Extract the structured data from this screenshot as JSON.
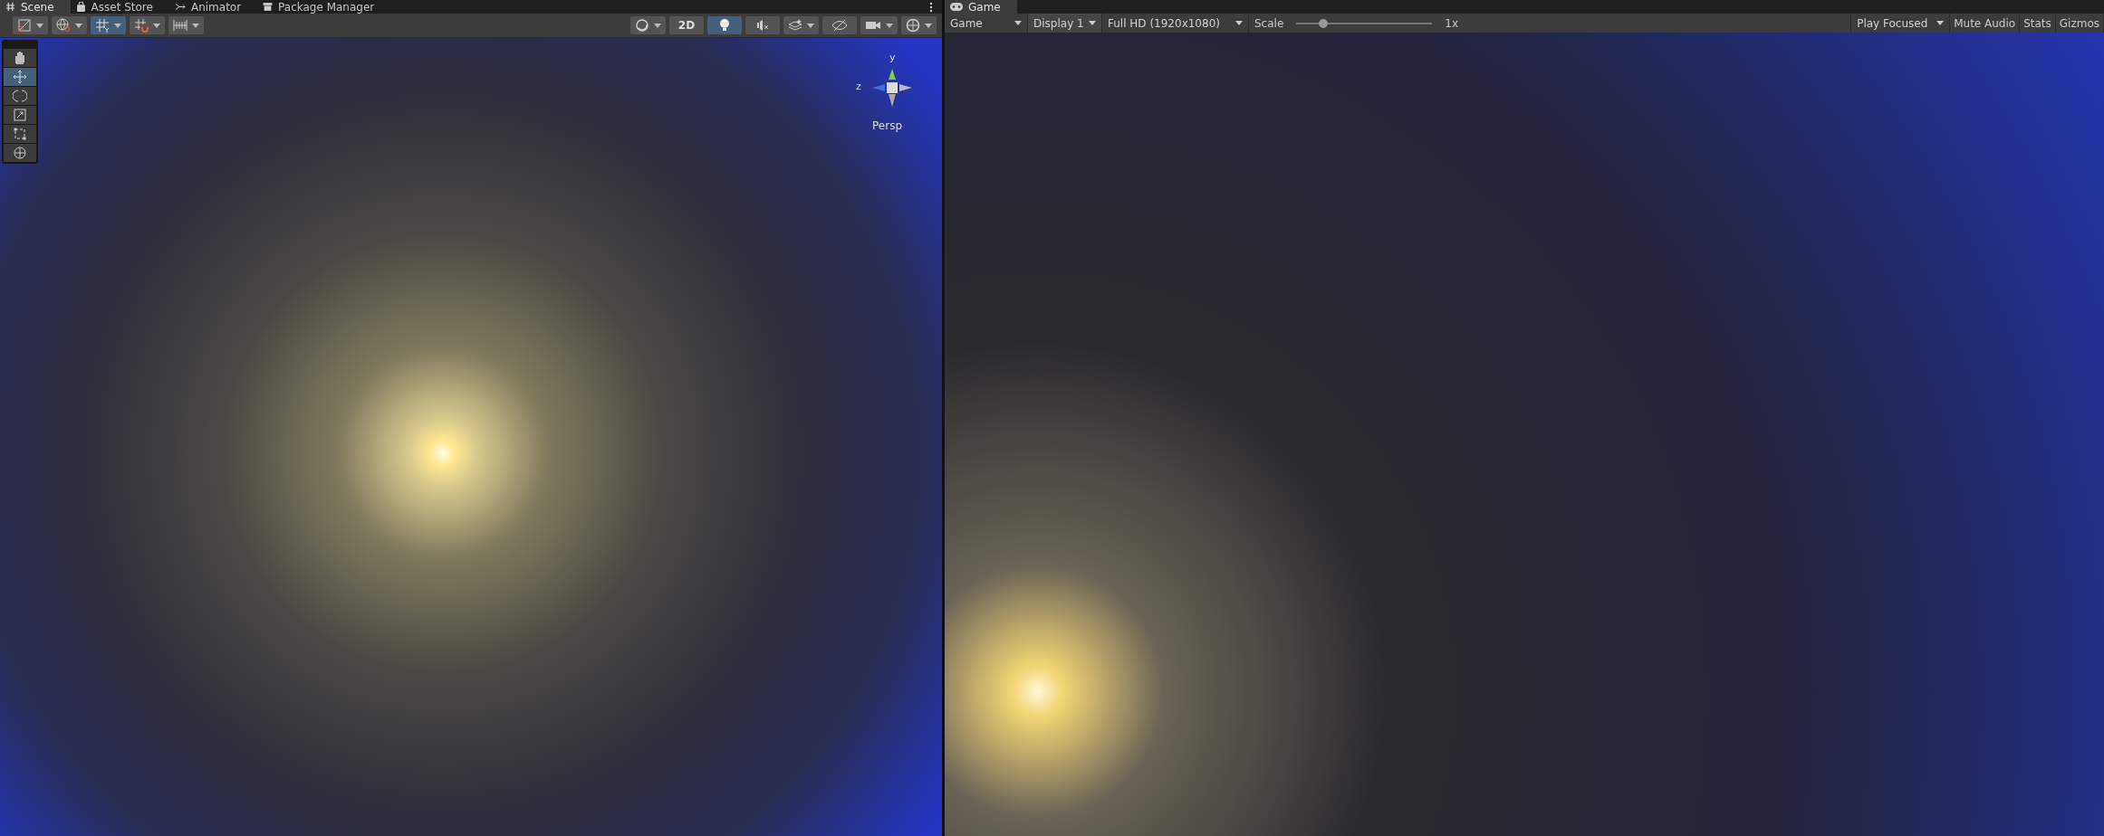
{
  "scene_tabs": [
    {
      "label": "Scene",
      "kind": "scene",
      "selected": true
    },
    {
      "label": "Asset Store",
      "kind": "store",
      "selected": false
    },
    {
      "label": "Animator",
      "kind": "animator",
      "selected": false
    },
    {
      "label": "Package Manager",
      "kind": "package",
      "selected": false
    }
  ],
  "scene_toolbar_left": [
    {
      "kind": "draw",
      "selected": false,
      "dropdown": true
    },
    {
      "kind": "globe",
      "selected": false,
      "dropdown": true
    },
    {
      "kind": "grid",
      "selected": true,
      "dropdown": true
    },
    {
      "kind": "snap",
      "selected": false,
      "dropdown": true
    },
    {
      "kind": "ruler",
      "selected": false,
      "dropdown": true
    }
  ],
  "scene_toolbar_right": [
    {
      "kind": "shading",
      "selected": false,
      "dropdown": true
    },
    {
      "kind": "text",
      "label": "2D",
      "selected": false,
      "dropdown": false
    },
    {
      "kind": "light",
      "selected": true,
      "dropdown": false
    },
    {
      "kind": "audio",
      "selected": false,
      "dropdown": false
    },
    {
      "kind": "effects",
      "selected": false,
      "dropdown": true
    },
    {
      "kind": "hidden",
      "selected": false,
      "dropdown": false
    },
    {
      "kind": "camera",
      "selected": false,
      "dropdown": true
    },
    {
      "kind": "gizmo",
      "selected": false,
      "dropdown": true
    }
  ],
  "tools": [
    {
      "kind": "hand",
      "selected": false
    },
    {
      "kind": "move",
      "selected": true
    },
    {
      "kind": "rotate",
      "selected": false
    },
    {
      "kind": "scale",
      "selected": false
    },
    {
      "kind": "rect",
      "selected": false
    },
    {
      "kind": "transform",
      "selected": false
    }
  ],
  "orientation_gizmo": {
    "y_label": "y",
    "z_label": "z",
    "projection": "Persp"
  },
  "game_tabs": [
    {
      "label": "Game",
      "selected": true
    }
  ],
  "game_toolbar": {
    "view": "Game",
    "display": "Display 1",
    "resolution": "Full HD (1920x1080)",
    "scale_label": "Scale",
    "scale": {
      "level": 0.2
    },
    "scale_reading": "1x",
    "play_mode": "Play Focused",
    "toggles": [
      {
        "label": "Mute Audio",
        "selected": false
      },
      {
        "label": "Stats",
        "selected": false
      },
      {
        "label": "Gizmos",
        "selected": false
      }
    ]
  }
}
